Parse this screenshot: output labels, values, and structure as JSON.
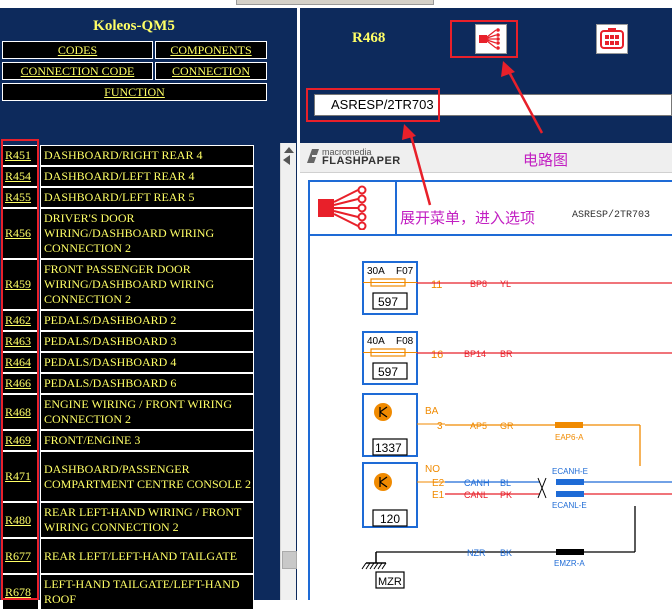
{
  "app": {
    "title": "Koleos-QM5"
  },
  "nav": {
    "codes": "CODES",
    "components": "COMPONENTS",
    "connection_code": "CONNECTION CODE",
    "connection": "CONNECTION",
    "function": "FUNCTION"
  },
  "list": [
    {
      "code": "R451",
      "desc": "DASHBOARD/RIGHT REAR 4"
    },
    {
      "code": "R454",
      "desc": "DASHBOARD/LEFT REAR 4"
    },
    {
      "code": "R455",
      "desc": "DASHBOARD/LEFT REAR 5"
    },
    {
      "code": "R456",
      "desc": "DRIVER'S DOOR WIRING/DASHBOARD WIRING CONNECTION 2"
    },
    {
      "code": "R459",
      "desc": "FRONT PASSENGER DOOR WIRING/DASHBOARD WIRING CONNECTION 2"
    },
    {
      "code": "R462",
      "desc": "PEDALS/DASHBOARD 2"
    },
    {
      "code": "R463",
      "desc": "PEDALS/DASHBOARD 3"
    },
    {
      "code": "R464",
      "desc": "PEDALS/DASHBOARD 4"
    },
    {
      "code": "R466",
      "desc": "PEDALS/DASHBOARD 6"
    },
    {
      "code": "R468",
      "desc": "ENGINE WIRING / FRONT WIRING CONNECTION 2"
    },
    {
      "code": "R469",
      "desc": "FRONT/ENGINE 3"
    },
    {
      "code": "R471",
      "desc": "DASHBOARD/PASSENGER COMPARTMENT CENTRE CONSOLE 2"
    },
    {
      "code": "R480",
      "desc": "REAR LEFT-HAND WIRING / FRONT WIRING CONNECTION 2"
    },
    {
      "code": "R677",
      "desc": "REAR LEFT/LEFT-HAND TAILGATE"
    },
    {
      "code": "R678",
      "desc": "LEFT-HAND TAILGATE/LEFT-HAND ROOF"
    }
  ],
  "header": {
    "selected_code": "R468"
  },
  "select": {
    "value": "ASRESP/2TR703"
  },
  "flashpaper": {
    "line1": "macromedia",
    "line2": "FLASHPAPER"
  },
  "annotations": {
    "expand_menu": "展开菜单，进入选项",
    "circuit_diagram": "电路图"
  },
  "doc": {
    "code": "ASRESP/2TR703"
  },
  "diagram": {
    "fuses": [
      {
        "rating": "30A",
        "id": "F07",
        "num": "597",
        "pin": "11",
        "wire": "BP8",
        "color": "YL"
      },
      {
        "rating": "40A",
        "id": "F08",
        "num": "597",
        "pin": "16",
        "wire": "BP14",
        "color": "BR"
      }
    ],
    "comp1337": {
      "num": "1337",
      "pin_label": "BA",
      "pin": "3",
      "wire": "AP5",
      "color": "GR",
      "conn": "EAP6-A"
    },
    "comp120": {
      "num": "120",
      "pin_label": "NO",
      "pins": [
        "E2",
        "E1"
      ],
      "wires": [
        "CANH",
        "CANL"
      ],
      "colors": [
        "BL",
        "PK"
      ],
      "conns": [
        "ECANH-E",
        "ECANL-E"
      ]
    },
    "ground": {
      "label": "MZR",
      "wire": "NZR",
      "color": "BK",
      "conn": "EMZR-A"
    },
    "colors": {
      "red": "#e8202a",
      "orange": "#f08a00",
      "blue": "#1e6bd6",
      "navy": "#0d2a5c",
      "yellow": "#ffff66",
      "magenta": "#c21fc2"
    }
  }
}
